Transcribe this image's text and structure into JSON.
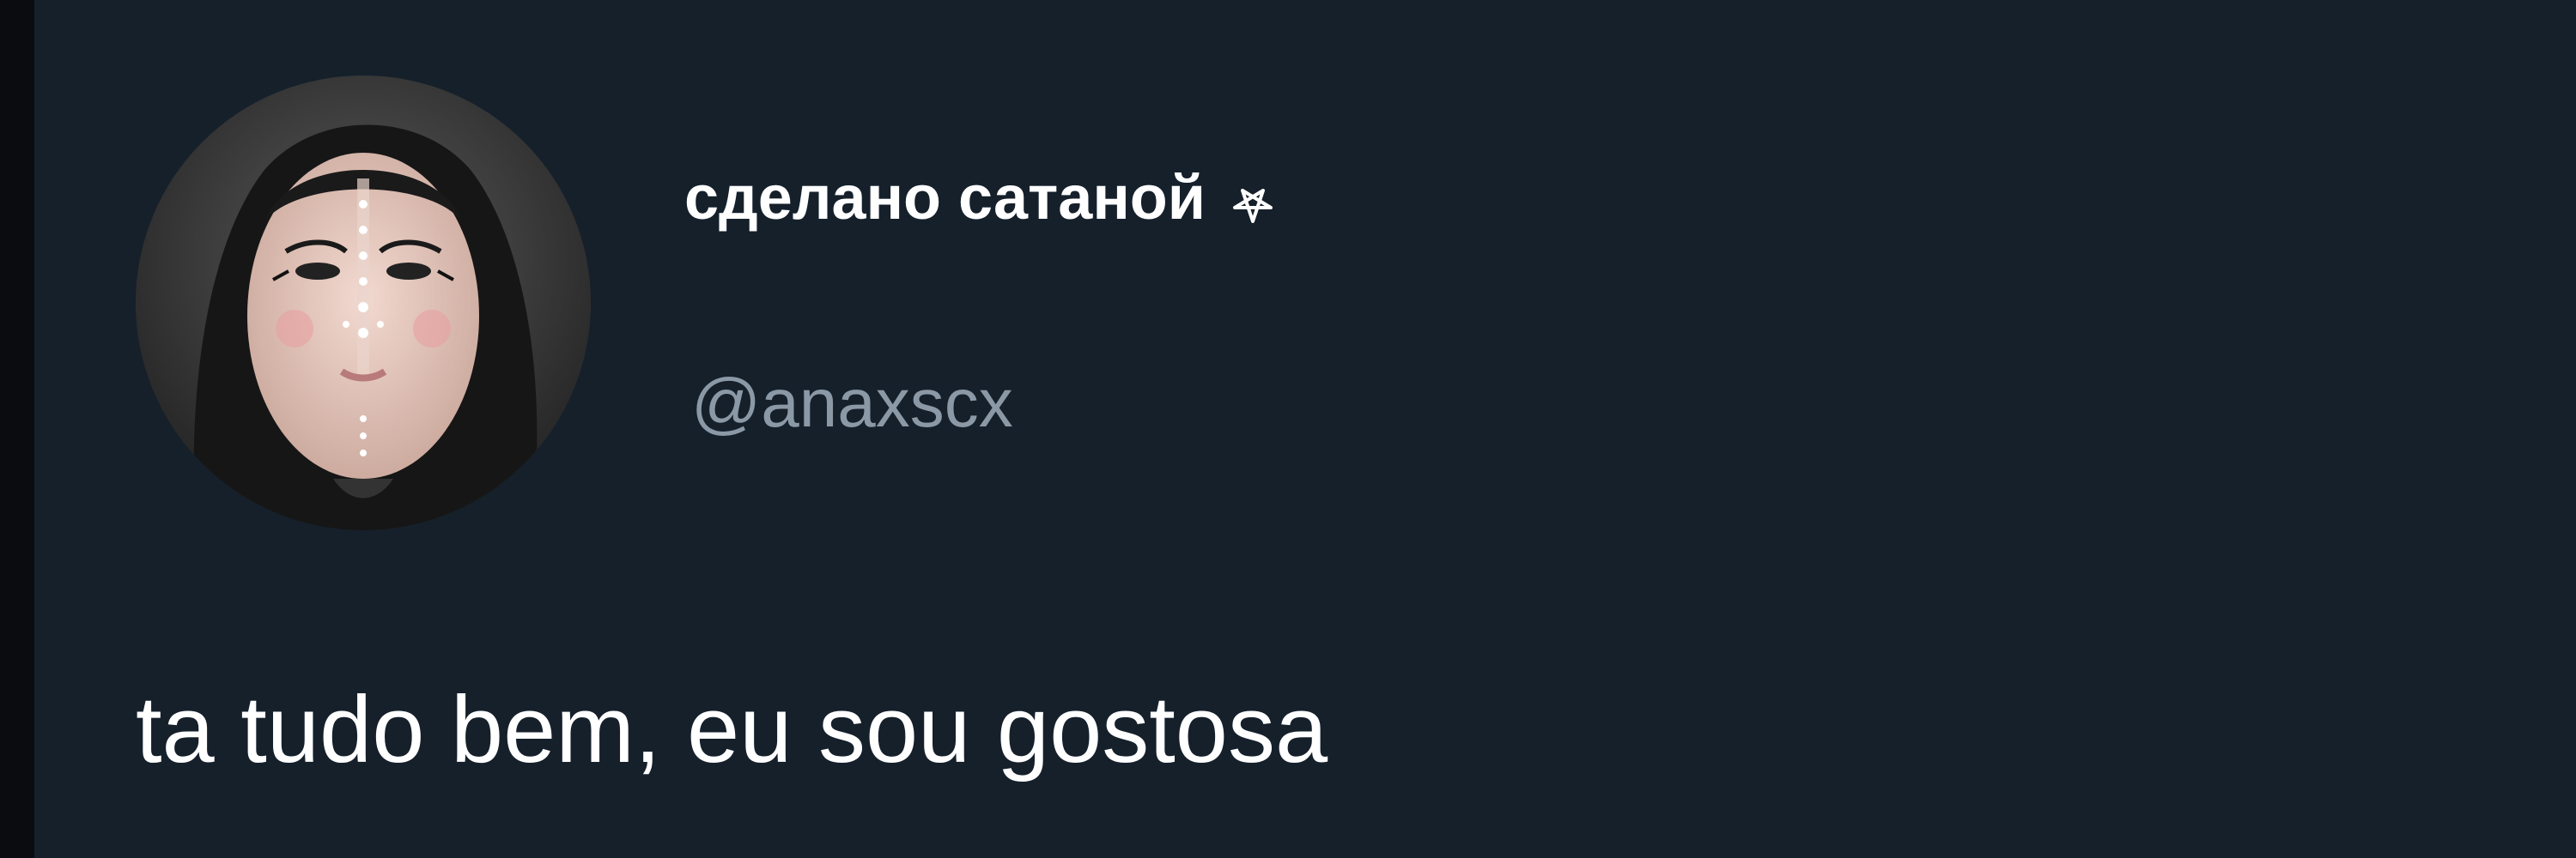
{
  "tweet": {
    "display_name": "сделано сатаной",
    "name_badge_icon": "pentagram-icon",
    "handle": "@anaxscx",
    "text": "ta tudo bem, eu sou gostosa",
    "avatar": "avatar"
  },
  "colors": {
    "background": "#15202b",
    "display_name": "#ffffff",
    "handle": "#8b98a5",
    "text": "#ffffff"
  }
}
